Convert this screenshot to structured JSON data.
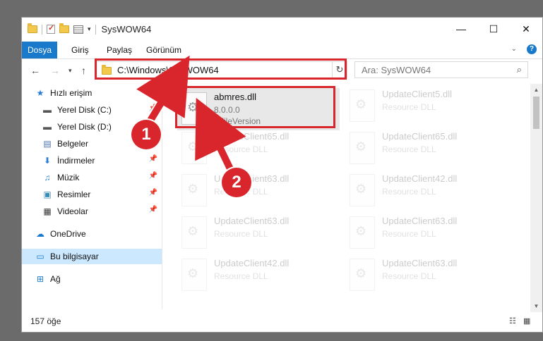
{
  "window": {
    "title": "SysWOW64",
    "minimize": "—",
    "maximize": "☐",
    "close": "✕"
  },
  "ribbon": {
    "tabs": [
      "Dosya",
      "Giriş",
      "Paylaş",
      "Görünüm"
    ],
    "help": "?"
  },
  "address": {
    "path": "C:\\Windows\\SysWOW64",
    "search_placeholder": "Ara: SysWOW64"
  },
  "sidebar": {
    "items": [
      {
        "label": "Hızlı erişim",
        "icon": "star-icon"
      },
      {
        "label": "Yerel Disk (C:)",
        "icon": "drive-icon",
        "pinned": true
      },
      {
        "label": "Yerel Disk (D:)",
        "icon": "drive-icon"
      },
      {
        "label": "Belgeler",
        "icon": "documents-icon",
        "pinned": true
      },
      {
        "label": "İndirmeler",
        "icon": "downloads-icon",
        "pinned": true
      },
      {
        "label": "Müzik",
        "icon": "music-icon",
        "pinned": true
      },
      {
        "label": "Resimler",
        "icon": "pictures-icon",
        "pinned": true
      },
      {
        "label": "Videolar",
        "icon": "videos-icon",
        "pinned": true
      },
      {
        "label": "OneDrive",
        "icon": "cloud-icon"
      },
      {
        "label": "Bu bilgisayar",
        "icon": "computer-icon",
        "selected": true
      },
      {
        "label": "Ağ",
        "icon": "network-icon"
      }
    ]
  },
  "files": [
    {
      "name": "abmres.dll",
      "line2": "8.0.0.0",
      "line3": "0FileVersion",
      "highlighted": true
    },
    {
      "name": "UpdateClient5.dll",
      "line2": "Resource DLL"
    },
    {
      "name": "UpdateClient65.dll",
      "line2": "Resource DLL"
    },
    {
      "name": "UpdateClient65.dll",
      "line2": "Resource DLL"
    },
    {
      "name": "UpdateClient63.dll",
      "line2": "Resource DLL"
    },
    {
      "name": "UpdateClient42.dll",
      "line2": "Resource DLL"
    },
    {
      "name": "UpdateClient63.dll",
      "line2": "Resource DLL"
    },
    {
      "name": "UpdateClient63.dll",
      "line2": "Resource DLL"
    },
    {
      "name": "UpdateClient42.dll",
      "line2": "Resource DLL"
    },
    {
      "name": "UpdateClient63.dll",
      "line2": "Resource DLL"
    }
  ],
  "status": {
    "count": "157 öğe"
  },
  "callouts": [
    "1",
    "2"
  ],
  "colors": {
    "accent": "#1979ca",
    "highlight": "#d8262c",
    "selected_nav": "#cce8ff"
  }
}
